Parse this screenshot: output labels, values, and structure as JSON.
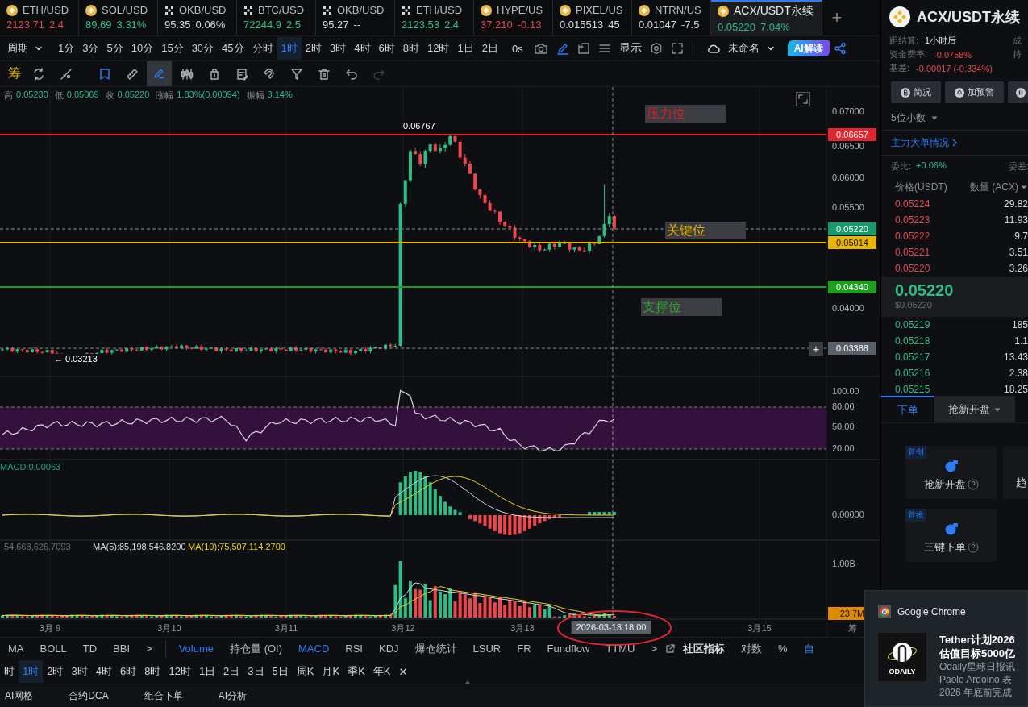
{
  "tickers": [
    {
      "symbol": "ETH/USD",
      "price": "2123.71",
      "change": "2.4",
      "color": "#e8484d",
      "kind": "coin",
      "selected": false
    },
    {
      "symbol": "SOL/USD",
      "price": "89.69",
      "change": "3.31%",
      "color": "#2ebd85",
      "kind": "coin",
      "selected": false
    },
    {
      "symbol": "OKB/USD",
      "price": "95.35",
      "change": "0.06%",
      "color": "#d5d7db",
      "kind": "cross",
      "selected": false
    },
    {
      "symbol": "BTC/USD",
      "price": "72244.9",
      "change": "2.5",
      "color": "#2ebd85",
      "kind": "cross",
      "selected": false
    },
    {
      "symbol": "OKB/USD",
      "price": "95.27",
      "change": "--",
      "color": "#d5d7db",
      "kind": "cross",
      "selected": false
    },
    {
      "symbol": "ETH/USD",
      "price": "2123.53",
      "change": "2.4",
      "color": "#2ebd85",
      "kind": "cross",
      "selected": false
    },
    {
      "symbol": "HYPE/US",
      "price": "37.210",
      "change": "-0.13",
      "color": "#e8484d",
      "kind": "coin",
      "selected": false
    },
    {
      "symbol": "PIXEL/US",
      "price": "0.015513",
      "change": "45",
      "color": "#d5d7db",
      "kind": "coin",
      "selected": false
    },
    {
      "symbol": "NTRN/US",
      "price": "0.01047",
      "change": "-7.5",
      "color": "#d5d7db",
      "kind": "coin",
      "selected": false
    },
    {
      "symbol": "ACX/USDT永续",
      "price": "0.05220",
      "change": "7.04%",
      "color": "#2ebd85",
      "kind": "coin",
      "selected": true
    }
  ],
  "add_tab": "+",
  "period_bar": {
    "menu": "周期",
    "periods": [
      {
        "label": "1分",
        "selected": false
      },
      {
        "label": "3分",
        "selected": false
      },
      {
        "label": "5分",
        "selected": false
      },
      {
        "label": "10分",
        "selected": false
      },
      {
        "label": "15分",
        "selected": false
      },
      {
        "label": "30分",
        "selected": false
      },
      {
        "label": "45分",
        "selected": false
      },
      {
        "label": "分时",
        "selected": false
      },
      {
        "label": "1时",
        "selected": true
      },
      {
        "label": "2时",
        "selected": false
      },
      {
        "label": "3时",
        "selected": false
      },
      {
        "label": "4时",
        "selected": false
      },
      {
        "label": "6时",
        "selected": false
      },
      {
        "label": "8时",
        "selected": false
      },
      {
        "label": "12时",
        "selected": false
      },
      {
        "label": "1日",
        "selected": false
      },
      {
        "label": "2日",
        "selected": false
      }
    ],
    "countdown": "0s",
    "display": "显示",
    "layout_name": "未命名",
    "ai_button": "AI解读"
  },
  "drawing_toolbar": {
    "chip": "筹",
    "tools": [
      {
        "selected": false,
        "disabled": false
      },
      {
        "selected": false,
        "disabled": false
      },
      {
        "selected": false,
        "disabled": false
      },
      {
        "selected": false,
        "disabled": false
      },
      {
        "selected": true,
        "disabled": false
      },
      {
        "selected": false,
        "disabled": false
      },
      {
        "selected": false,
        "disabled": false
      },
      {
        "selected": false,
        "disabled": false
      },
      {
        "selected": false,
        "disabled": false
      },
      {
        "selected": false,
        "disabled": false
      },
      {
        "selected": false,
        "disabled": false
      },
      {
        "selected": false,
        "disabled": false
      },
      {
        "selected": false,
        "disabled": true
      }
    ]
  },
  "chart": {
    "ohlc": [
      {
        "label": "高",
        "value": "0.05230"
      },
      {
        "label": "低",
        "value": "0.05069"
      },
      {
        "label": "收",
        "value": "0.05220"
      },
      {
        "label": "涨幅",
        "value": "1.83%(0.00094)"
      },
      {
        "label": "振幅",
        "value": "3.14%"
      }
    ],
    "price_axis": [
      "0.07000",
      "0.06500",
      "0.06000",
      "0.05500",
      "0.04000"
    ],
    "price_lines": [
      {
        "label": "0.06657",
        "color": "#e0262f",
        "kind": "solid"
      },
      {
        "label": "0.05220",
        "color": "#1a9a6c",
        "kind": "dashed"
      },
      {
        "label": "0.05014",
        "color": "#e8b600",
        "kind": "solid"
      },
      {
        "label": "0.04340",
        "color": "#1f9e1f",
        "kind": "solid"
      },
      {
        "label": "0.03388",
        "color": "#5a6068",
        "kind": "dashed"
      }
    ],
    "plus": "+",
    "annotations": [
      {
        "text": "压力位",
        "kind": "resistance"
      },
      {
        "text": "关键位",
        "kind": "key"
      },
      {
        "text": "支撑位",
        "kind": "support"
      }
    ],
    "high_marker": "0.06767",
    "low_marker": "← 0.03213",
    "rsi_axis": [
      "100.00",
      "80.00",
      "50.00",
      "20.00"
    ],
    "macd_label": "MACD:0.00063",
    "macd_axis": "0.00000",
    "volume_labels": [
      {
        "text": "54,668,626.7093",
        "color": "#6b7079"
      },
      {
        "text": "MA(5):85,198,546.8200",
        "color": "#d5d7db"
      },
      {
        "text": "MA(10):75,507,114.2700",
        "color": "#e8d21d"
      }
    ],
    "volume_axis": "1.00B",
    "volume_last": "23.7M",
    "time_axis": [
      "3月 9",
      "3月10",
      "3月11",
      "3月12",
      "3月13",
      "3月15"
    ],
    "crosshair_time": "2026-03-13 18:00",
    "corner_label": "筹"
  },
  "indicator_bar": {
    "main": [
      "MA",
      "BOLL",
      "TD",
      "BBI"
    ],
    "main_more": ">",
    "sub": [
      {
        "label": "Volume",
        "active": true
      },
      {
        "label": "持仓量 (OI)",
        "active": false
      },
      {
        "label": "MACD",
        "active": true
      },
      {
        "label": "RSI",
        "active": false
      },
      {
        "label": "KDJ",
        "active": false
      },
      {
        "label": "爆仓统计",
        "active": false
      },
      {
        "label": "LSUR",
        "active": false
      },
      {
        "label": "FR",
        "active": false
      },
      {
        "label": "Fundflow",
        "active": false
      },
      {
        "label": "TTMU",
        "active": false
      }
    ],
    "sub_more": ">",
    "community": "社区指标",
    "log": "对数",
    "percent": "%",
    "auto": "自"
  },
  "period_bar_2": {
    "periods": [
      {
        "label": "时",
        "selected": false
      },
      {
        "label": "1时",
        "selected": true
      },
      {
        "label": "2时",
        "selected": false
      },
      {
        "label": "3时",
        "selected": false
      },
      {
        "label": "4时",
        "selected": false
      },
      {
        "label": "6时",
        "selected": false
      },
      {
        "label": "8时",
        "selected": false
      },
      {
        "label": "12时",
        "selected": false
      },
      {
        "label": "1日",
        "selected": false
      },
      {
        "label": "2日",
        "selected": false
      },
      {
        "label": "3日",
        "selected": false
      },
      {
        "label": "5日",
        "selected": false
      },
      {
        "label": "周K",
        "selected": false
      },
      {
        "label": "月K",
        "selected": false
      },
      {
        "label": "季K",
        "selected": false
      },
      {
        "label": "年K",
        "selected": false
      }
    ],
    "close": "✕"
  },
  "bottom_tabs": [
    "AI网格",
    "合约DCA",
    "组合下单",
    "AI分析"
  ],
  "contract": {
    "title": "ACX/USDT永续",
    "stats": [
      {
        "label": "距结算:",
        "value": "1小时后",
        "side": "成"
      },
      {
        "label": "资金费率:",
        "value": "-0.0758%",
        "color": "#e8484d",
        "side": "持"
      },
      {
        "label": "基差:",
        "value": "-0.00017 (-0.334%)",
        "color": "#e8484d"
      }
    ],
    "buttons": [
      "简况",
      "加预警"
    ],
    "decimals": "5位小数",
    "big_orders": "主力大单情况",
    "ratio_label": "委比:",
    "ratio_value": "+0.06%",
    "diff_label": "委差:"
  },
  "order_book": {
    "columns": [
      "价格(USDT)",
      "数量 (ACX)"
    ],
    "asks": [
      {
        "price": "0.05224",
        "qty": "29.82"
      },
      {
        "price": "0.05223",
        "qty": "11.93"
      },
      {
        "price": "0.05222",
        "qty": "9.7"
      },
      {
        "price": "0.05221",
        "qty": "3.51"
      },
      {
        "price": "0.05220",
        "qty": "3.26"
      }
    ],
    "last": "0.05220",
    "last_usd": "$0.05220",
    "bids": [
      {
        "price": "0.05219",
        "qty": "185"
      },
      {
        "price": "0.05218",
        "qty": "1.1"
      },
      {
        "price": "0.05217",
        "qty": "13.43"
      },
      {
        "price": "0.05216",
        "qty": "2.38"
      },
      {
        "price": "0.05215",
        "qty": "18.25"
      }
    ]
  },
  "order_tabs": [
    {
      "label": "下单",
      "selected": true,
      "dropdown": false
    },
    {
      "label": "抢新开盘",
      "selected": false,
      "dropdown": true
    }
  ],
  "cards": [
    {
      "badge": "首创",
      "label": "抢新开盘"
    },
    {
      "label": "趋"
    },
    {
      "badge": "首推",
      "label": "三键下单"
    }
  ],
  "notification": {
    "app": "Google Chrome",
    "logo_text": "ODAILY",
    "title_lines": [
      "Tether计划2026",
      "估值目标5000亿"
    ],
    "body_lines": [
      "Odaily星球日报讯",
      "Paolo Ardoino 表",
      "2026 年底前完成"
    ]
  }
}
